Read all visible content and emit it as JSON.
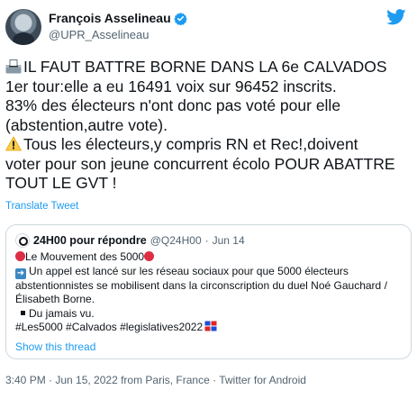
{
  "author": {
    "display_name": "François Asselineau",
    "handle": "@UPR_Asselineau",
    "verified_icon": "verified-badge-icon"
  },
  "tweet": {
    "lines": [
      "IL FAUT BATTRE BORNE DANS LA 6e CALVADOS",
      "1er tour:elle a eu 16491 voix sur 96452 inscrits.",
      "83% des électeurs n'ont donc pas voté pour elle",
      "(abstention,autre vote).",
      "Tous les électeurs,y compris RN et Rec!,doivent",
      "voter pour son jeune concurrent écolo POUR ABATTRE",
      "TOUT LE GVT !"
    ],
    "translate_label": "Translate Tweet"
  },
  "quote": {
    "name": "24H00 pour répondre",
    "handle": "@Q24H00",
    "separator": "·",
    "date": "Jun 14",
    "lines": [
      "Le Mouvement des 5000",
      "Un appel est lancé sur les réseau sociaux pour que 5000 électeurs",
      "abstentionnistes se mobilisent dans la circonscription du duel Noé Gauchard /",
      "Élisabeth Borne.",
      "Du jamais vu.",
      "#Les5000 #Calvados  #legislatives2022"
    ],
    "show_thread_label": "Show this thread"
  },
  "meta": {
    "text": "3:40 PM · Jun 15, 2022 from Paris, France · Twitter for Android"
  },
  "colors": {
    "link": "#1d9bf0",
    "muted": "#536471",
    "text": "#0f1419",
    "border": "#cfd9de"
  }
}
